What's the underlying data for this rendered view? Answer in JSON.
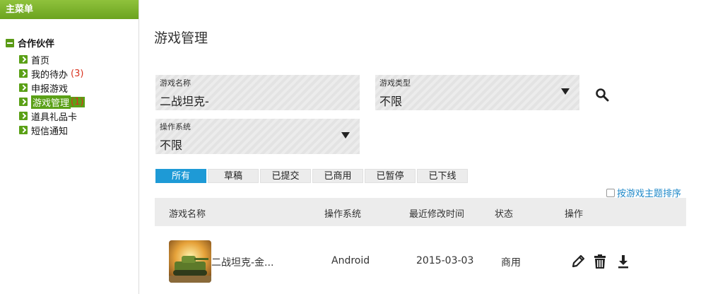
{
  "sidebar": {
    "header": "主菜单",
    "group_label": "合作伙伴",
    "items": [
      {
        "label": "首页",
        "count": ""
      },
      {
        "label": "我的待办",
        "count": "(3)"
      },
      {
        "label": "申报游戏",
        "count": ""
      },
      {
        "label": "游戏管理",
        "count": "(1)"
      },
      {
        "label": "道具礼品卡",
        "count": ""
      },
      {
        "label": "短信通知",
        "count": ""
      }
    ]
  },
  "main": {
    "title": "游戏管理",
    "filters": {
      "game_name": {
        "label": "游戏名称",
        "value": "二战坦克-"
      },
      "game_type": {
        "label": "游戏类型",
        "value": "不限"
      },
      "os": {
        "label": "操作系统",
        "value": "不限"
      }
    },
    "tabs": [
      "所有",
      "草稿",
      "已提交",
      "已商用",
      "已暂停",
      "已下线"
    ],
    "active_tab": "所有",
    "sort_option": "按游戏主题排序",
    "table": {
      "columns": [
        "游戏名称",
        "操作系统",
        "最近修改时间",
        "状态",
        "操作"
      ],
      "rows": [
        {
          "name": "二战坦克-金...",
          "os": "Android",
          "modified": "2015-03-03",
          "status": "商用"
        }
      ]
    }
  },
  "colors": {
    "sidebar_green": "#6ba31f",
    "accent_blue": "#1e9ad6",
    "count_red": "#d9331f"
  }
}
